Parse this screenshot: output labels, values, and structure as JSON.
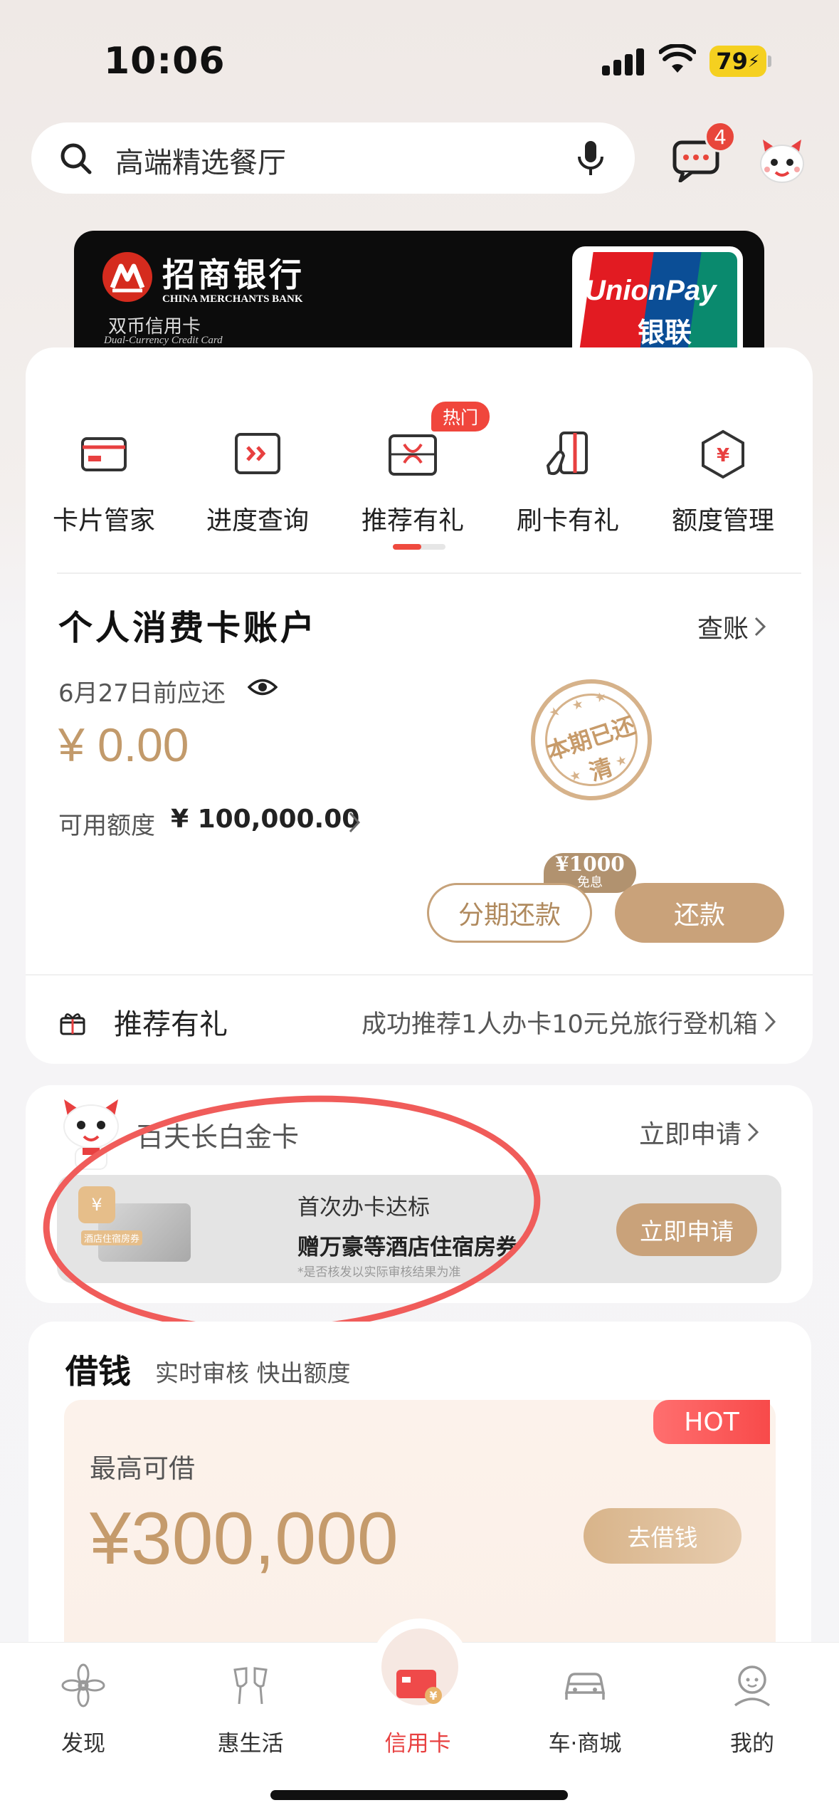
{
  "status": {
    "time": "10:06",
    "battery": "79"
  },
  "search": {
    "placeholder": "高端精选餐厅"
  },
  "messages": {
    "badge": "4"
  },
  "card": {
    "bank_name": "招商银行",
    "bank_name_en": "CHINA MERCHANTS BANK",
    "card_type": "双币信用卡",
    "card_type_en": "Dual-Currency Credit Card",
    "network": "UnionPay",
    "network_cn": "银联"
  },
  "quick_actions": [
    {
      "label": "卡片管家",
      "icon": "card-icon"
    },
    {
      "label": "进度查询",
      "icon": "progress-icon"
    },
    {
      "label": "推荐有礼",
      "icon": "gift-box-icon",
      "tag": "热门"
    },
    {
      "label": "刷卡有礼",
      "icon": "swipe-card-icon"
    },
    {
      "label": "额度管理",
      "icon": "limit-icon"
    }
  ],
  "account": {
    "title": "个人消费卡账户",
    "bill_link": "查账",
    "due_label": "6月27日前应还",
    "amount": "¥ 0.00",
    "stamp": "本期已还清",
    "credit_label": "可用额度",
    "credit_value": "¥ 100,000.00",
    "promo_amount": "¥1000",
    "promo_note": "免息",
    "installment_button": "分期还款",
    "repay_button": "还款"
  },
  "referral": {
    "label": "推荐有礼",
    "desc": "成功推荐1人办卡10元兑旅行登机箱"
  },
  "platinum": {
    "title": "百夫长白金卡",
    "apply_link": "立即申请",
    "badge_text": "酒店住宿房券",
    "offer_line1": "首次办卡达标",
    "offer_line2": "赠万豪等酒店住宿房券",
    "offer_note": "*是否核发以实际审核结果为准",
    "offer_button": "立即申请"
  },
  "loan": {
    "title": "借钱",
    "subtitle": "实时审核 快出额度",
    "hot": "HOT",
    "label": "最高可借",
    "amount": "¥300,000",
    "button": "去借钱"
  },
  "tabs": [
    {
      "label": "发现",
      "icon": "discover-icon"
    },
    {
      "label": "惠生活",
      "icon": "cheers-icon"
    },
    {
      "label": "信用卡",
      "icon": "credit-card-icon",
      "active": true
    },
    {
      "label": "车·商城",
      "icon": "car-icon"
    },
    {
      "label": "我的",
      "icon": "profile-icon"
    }
  ],
  "colors": {
    "accent": "#c9a27a",
    "red": "#e84040",
    "annotation": "#f05c5a"
  }
}
